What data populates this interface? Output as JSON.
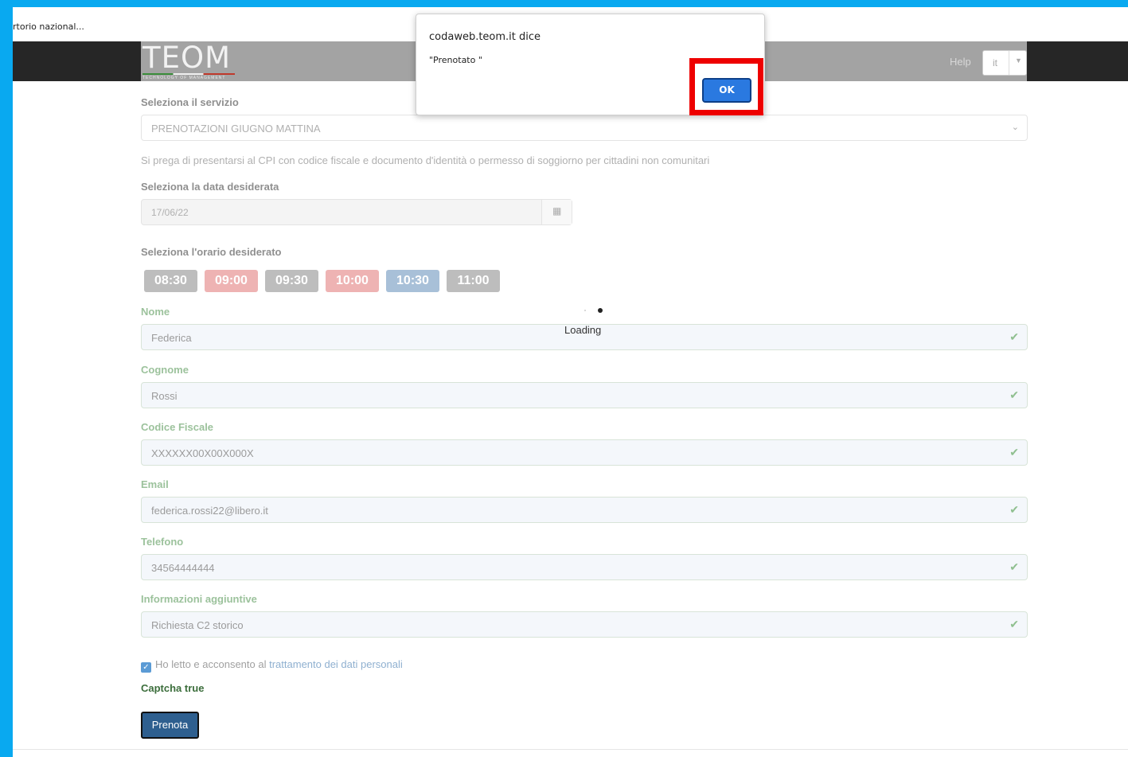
{
  "browser": {
    "tab_title": "rtorio nazional..."
  },
  "navbar": {
    "logo_text": "TEOM",
    "logo_subtitle": "TECHNOLOGY OF MANAGEMENT",
    "help_label": "Help",
    "language_value": "it"
  },
  "form": {
    "service_label": "Seleziona il servizio",
    "service_value": "PRENOTAZIONI GIUGNO MATTINA",
    "notice": "Si prega di presentarsi al CPI con codice fiscale e documento d'identità o permesso di soggiorno per cittadini non comunitari",
    "date_label": "Seleziona la data desiderata",
    "date_value": "17/06/22",
    "time_label": "Seleziona l'orario desiderato",
    "time_slots": [
      "08:30",
      "09:00",
      "09:30",
      "10:00",
      "10:30",
      "11:00"
    ],
    "loading_text": "Loading",
    "nome_label": "Nome",
    "nome_value": "Federica",
    "cognome_label": "Cognome",
    "cognome_value": "Rossi",
    "cf_label": "Codice Fiscale",
    "cf_value": "XXXXXX00X00X000X",
    "email_label": "Email",
    "email_value": "federica.rossi22@libero.it",
    "telefono_label": "Telefono",
    "telefono_value": "34564444444",
    "info_label": "Informazioni aggiuntive",
    "info_value": "Richiesta C2 storico",
    "consent_text": "Ho letto e acconsento al",
    "consent_link": "trattamento dei dati personali",
    "captcha_text": "Captcha true",
    "submit_label": "Prenota"
  },
  "dialog": {
    "title": "codaweb.teom.it dice",
    "message": "\"Prenotato \"",
    "ok_label": "OK"
  },
  "colors": {
    "frame": "#09a9f0",
    "highlight": "#ee0000",
    "ok_button": "#2a79e0",
    "submit_button": "#2e5f8f"
  }
}
